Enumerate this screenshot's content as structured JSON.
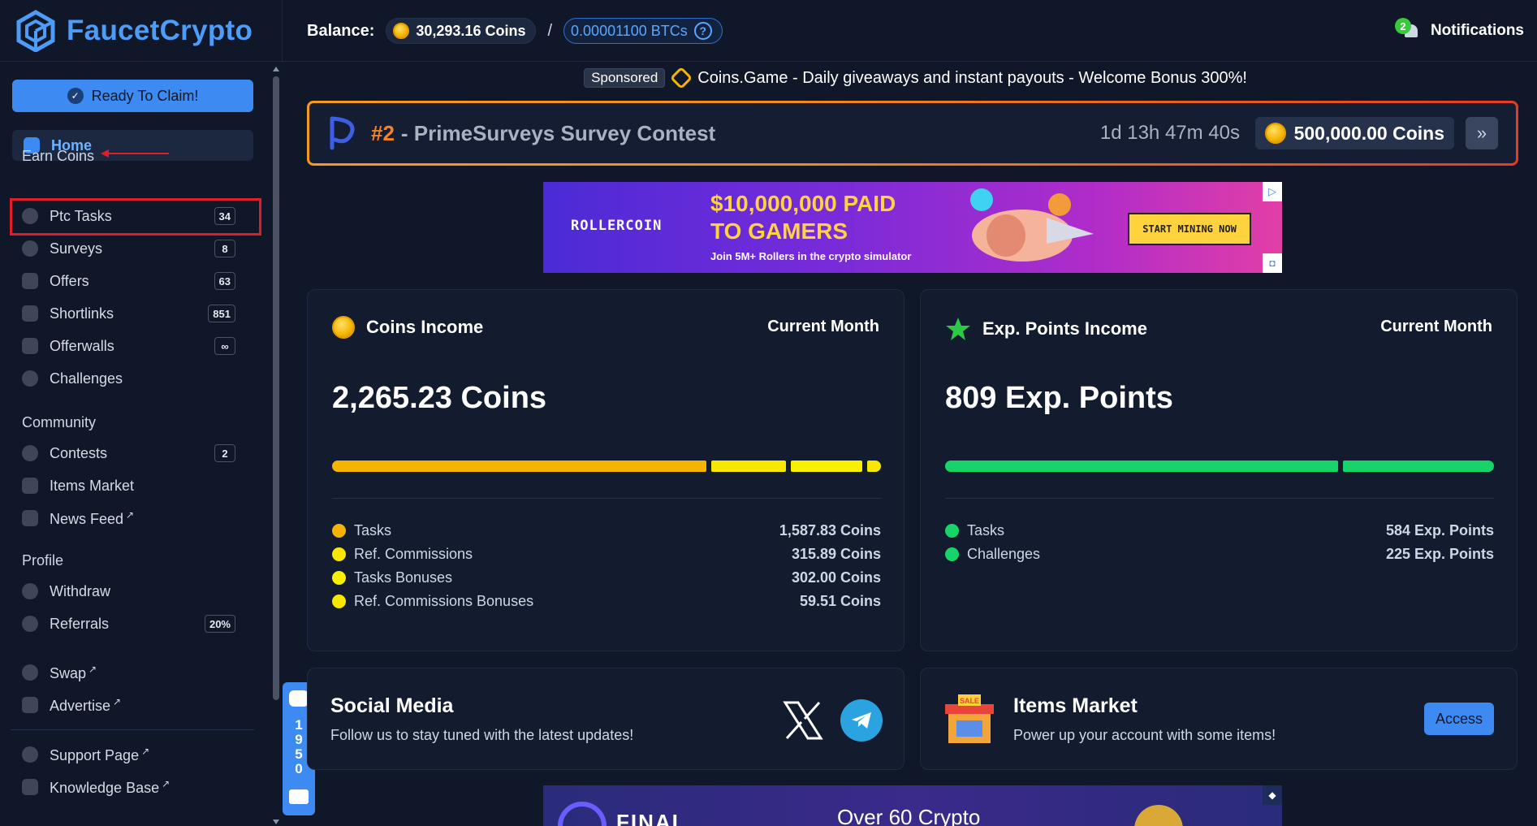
{
  "header": {
    "logo_text": "FaucetCrypto",
    "balance_label": "Balance:",
    "coins_balance": "30,293.16 Coins",
    "separator": "/",
    "btc_balance": "0.00001100 BTCs",
    "help_glyph": "?",
    "notifications_label": "Notifications",
    "notifications_count": "2"
  },
  "sidebar": {
    "claim_button": "Ready To Claim!",
    "home": "Home",
    "sections": {
      "earn": "Earn Coins",
      "community": "Community",
      "profile": "Profile"
    },
    "earn_items": [
      {
        "label": "Ptc Tasks",
        "badge": "34",
        "icon": "eye-icon"
      },
      {
        "label": "Surveys",
        "badge": "8",
        "icon": "survey-icon"
      },
      {
        "label": "Offers",
        "badge": "63",
        "icon": "offers-icon"
      },
      {
        "label": "Shortlinks",
        "badge": "851",
        "icon": "link-icon"
      },
      {
        "label": "Offerwalls",
        "badge": "∞",
        "icon": "offerwall-icon"
      },
      {
        "label": "Challenges",
        "badge": "",
        "icon": "target-icon"
      }
    ],
    "community_items": [
      {
        "label": "Contests",
        "badge": "2",
        "icon": "trophy-icon"
      },
      {
        "label": "Items Market",
        "badge": "",
        "icon": "market-icon"
      },
      {
        "label": "News Feed",
        "badge": "",
        "icon": "news-icon",
        "external": "↗"
      }
    ],
    "profile_items": [
      {
        "label": "Withdraw",
        "badge": "",
        "icon": "withdraw-icon"
      },
      {
        "label": "Referrals",
        "badge": "20%",
        "icon": "referrals-icon"
      }
    ],
    "extra_items": [
      {
        "label": "Swap",
        "icon": "swap-icon",
        "external": "↗"
      },
      {
        "label": "Advertise",
        "icon": "advertise-icon",
        "external": "↗"
      }
    ],
    "help_items": [
      {
        "label": "Support Page",
        "icon": "support-icon",
        "external": "↗"
      },
      {
        "label": "Knowledge Base",
        "icon": "knowledge-icon",
        "external": "↗"
      }
    ]
  },
  "chat_widget": {
    "count": "1950"
  },
  "sponsored": {
    "tag": "Sponsored",
    "text": "Coins.Game - Daily giveaways and instant payouts - Welcome Bonus 300%!"
  },
  "contest": {
    "rank": "#2",
    "title": "- PrimeSurveys Survey Contest",
    "timer": "1d 13h 47m 40s",
    "prize": "500,000.00 Coins",
    "next_glyph": "»"
  },
  "ad_banner": {
    "brand": "ROLLERCOIN",
    "headline_1": "$10,000,000 PAID",
    "headline_2": "TO GAMERS",
    "subtext": "Join 5M+ Rollers in the crypto simulator",
    "cta": "START MINING NOW"
  },
  "coins_income": {
    "title": "Coins Income",
    "period": "Current Month",
    "total": "2,265.23 Coins",
    "breakdown": [
      {
        "label": "Tasks",
        "value": "1,587.83 Coins",
        "amount": 1587.83,
        "color": "#f5b400"
      },
      {
        "label": "Ref. Commissions",
        "value": "315.89 Coins",
        "amount": 315.89,
        "color": "#f8e800"
      },
      {
        "label": "Tasks Bonuses",
        "value": "302.00 Coins",
        "amount": 302.0,
        "color": "#f8f000"
      },
      {
        "label": "Ref. Commissions Bonuses",
        "value": "59.51 Coins",
        "amount": 59.51,
        "color": "#f8e800"
      }
    ]
  },
  "exp_income": {
    "title": "Exp. Points Income",
    "period": "Current Month",
    "total": "809 Exp. Points",
    "breakdown": [
      {
        "label": "Tasks",
        "value": "584 Exp. Points",
        "amount": 584,
        "color": "#16d46a"
      },
      {
        "label": "Challenges",
        "value": "225 Exp. Points",
        "amount": 225,
        "color": "#16d46a"
      }
    ]
  },
  "social": {
    "title": "Social Media",
    "subtitle": "Follow us to stay tuned with the latest updates!"
  },
  "items_market": {
    "title": "Items Market",
    "subtitle": "Power up your account with some items!",
    "button": "Access",
    "icon_label": "SALE"
  },
  "bottom_ad": {
    "brand": "FINAL",
    "text": "Over 60 Crypto"
  },
  "colors": {
    "accent": "#3d8bf2",
    "background": "#0f1729",
    "card": "#131c2f",
    "highlight": "#e01e2a"
  }
}
